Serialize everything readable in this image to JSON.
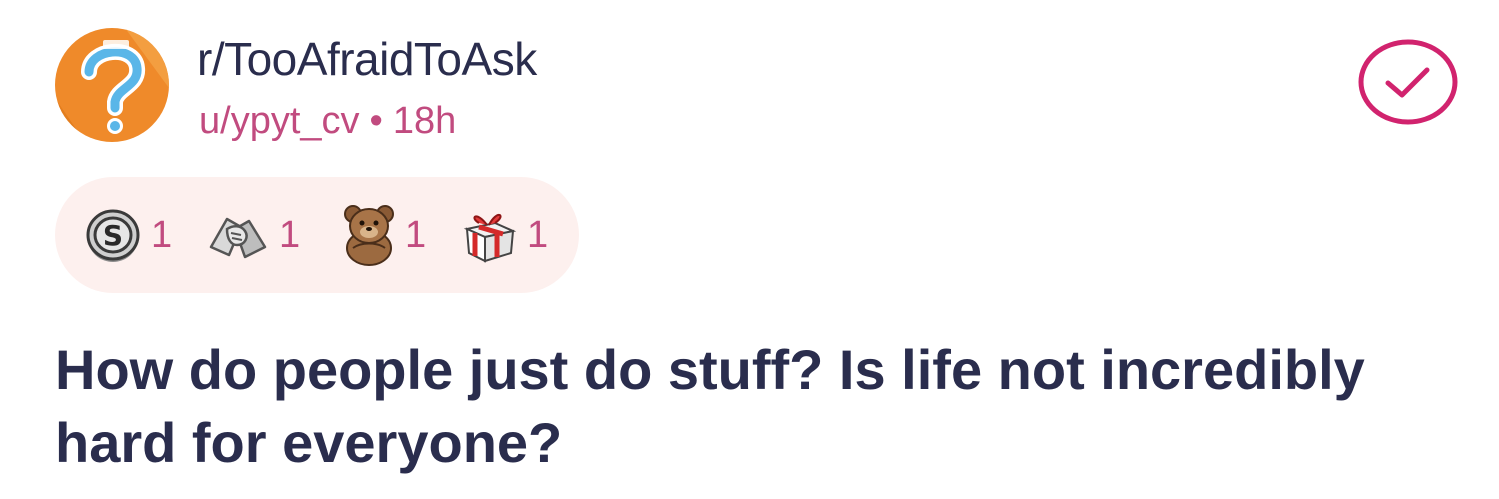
{
  "post": {
    "subreddit": "r/TooAfraidToAsk",
    "author": "u/ypyt_cv",
    "separator": "•",
    "time_ago": "18h",
    "title": "How do people just do stuff? Is life not incredibly hard for everyone?",
    "saved": true
  },
  "awards": [
    {
      "icon": "silver-coin-icon",
      "count": "1"
    },
    {
      "icon": "handshake-icon",
      "count": "1"
    },
    {
      "icon": "bear-icon",
      "count": "1"
    },
    {
      "icon": "gift-icon",
      "count": "1"
    }
  ],
  "colors": {
    "title": "#2a2d4d",
    "meta": "#c14b7f",
    "accent": "#d1236e",
    "awards_background": "#fdf0ee",
    "avatar_orange": "#ef8a2a"
  }
}
